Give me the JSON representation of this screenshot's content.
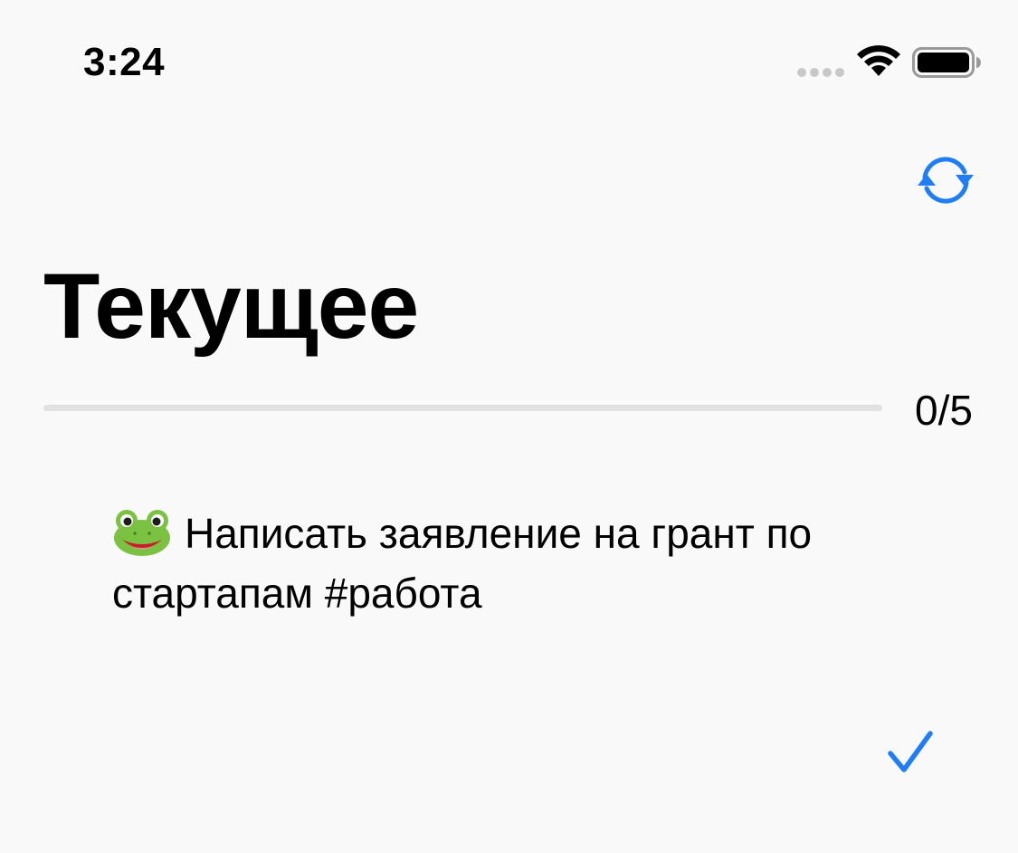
{
  "status_bar": {
    "time": "3:24",
    "signal_icon": "cellular-signal-dots-icon",
    "wifi_icon": "wifi-icon",
    "battery_icon": "battery-full-icon"
  },
  "toolbar": {
    "refresh_icon": "refresh-icon"
  },
  "header": {
    "title": "Текущее"
  },
  "progress": {
    "completed": 0,
    "total": 5,
    "label": "0/5"
  },
  "task": {
    "emoji_icon": "frog-face-icon",
    "text": "Написать заявление на грант по стартапам #работа"
  },
  "actions": {
    "complete_icon": "checkmark-icon"
  },
  "colors": {
    "background": "#f9f9f9",
    "accent": "#1f7ef6",
    "progress_track": "#e1e1e1",
    "text": "#000000"
  }
}
